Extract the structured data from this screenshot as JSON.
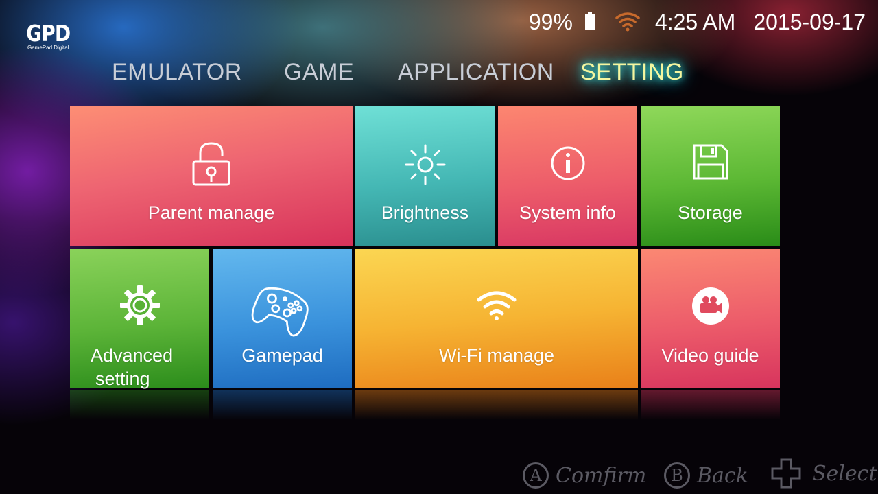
{
  "logo": {
    "brand": "GPD",
    "tagline": "GamePad Digital"
  },
  "status_bar": {
    "battery_percent": "99%",
    "time": "4:25 AM",
    "date": "2015-09-17",
    "wifi_color": "#c86a2c"
  },
  "tabs": [
    {
      "label": "EMULATOR",
      "active": false
    },
    {
      "label": "GAME",
      "active": false
    },
    {
      "label": "APPLICATION",
      "active": false
    },
    {
      "label": "SETTING",
      "active": true
    }
  ],
  "tiles": {
    "parent_manage": {
      "label": "Parent manage",
      "icon": "unlock-icon"
    },
    "brightness": {
      "label": "Brightness",
      "icon": "sun-icon"
    },
    "system_info": {
      "label": "System info",
      "icon": "info-icon"
    },
    "storage": {
      "label": "Storage",
      "icon": "floppy-disk-icon"
    },
    "advanced_setting": {
      "label_line1": "Advanced",
      "label_line2": "setting",
      "icon": "gear-icon"
    },
    "gamepad": {
      "label": "Gamepad",
      "icon": "gamepad-icon"
    },
    "wifi_manage": {
      "label": "Wi-Fi manage",
      "icon": "wifi-icon"
    },
    "video_guide": {
      "label": "Video guide",
      "icon": "video-camera-icon"
    }
  },
  "hints": {
    "confirm": {
      "key": "A",
      "label": "Comfirm"
    },
    "back": {
      "key": "B",
      "label": "Back"
    },
    "select": {
      "label": "Select"
    }
  }
}
